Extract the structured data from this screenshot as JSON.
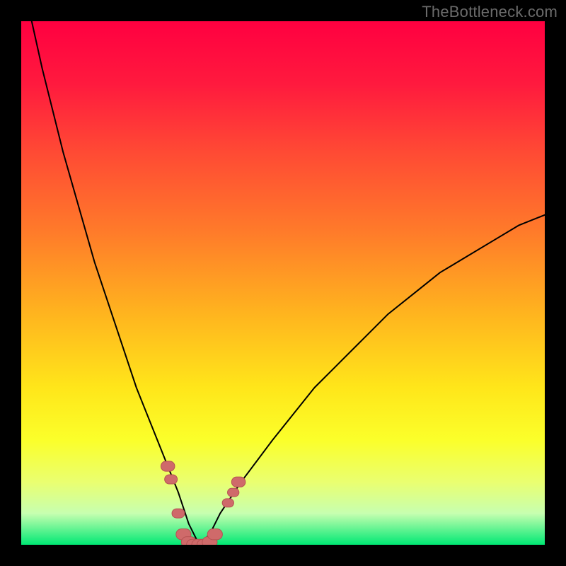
{
  "watermark": "TheBottleneck.com",
  "colors": {
    "curve": "#000000",
    "marker_fill": "#cf6a6a",
    "marker_stroke": "#b55252",
    "gradient_stops": [
      {
        "offset": "0%",
        "color": "#ff0040"
      },
      {
        "offset": "12%",
        "color": "#ff1a3e"
      },
      {
        "offset": "25%",
        "color": "#ff4a34"
      },
      {
        "offset": "40%",
        "color": "#ff7a2a"
      },
      {
        "offset": "55%",
        "color": "#ffb11f"
      },
      {
        "offset": "70%",
        "color": "#ffe61a"
      },
      {
        "offset": "80%",
        "color": "#fbff2a"
      },
      {
        "offset": "88%",
        "color": "#eaff70"
      },
      {
        "offset": "94%",
        "color": "#c7ffb0"
      },
      {
        "offset": "100%",
        "color": "#00e874"
      }
    ]
  },
  "chart_data": {
    "type": "line",
    "title": "",
    "xlabel": "",
    "ylabel": "",
    "xlim": [
      0,
      100
    ],
    "ylim": [
      0,
      100
    ],
    "x_optimum": 34,
    "series": [
      {
        "name": "bottleneck-curve",
        "x": [
          0,
          2,
          4,
          6,
          8,
          10,
          12,
          14,
          16,
          18,
          20,
          22,
          24,
          26,
          28,
          30,
          31,
          32,
          33,
          34,
          35,
          36,
          37,
          38,
          40,
          42,
          45,
          48,
          52,
          56,
          60,
          65,
          70,
          75,
          80,
          85,
          90,
          95,
          100
        ],
        "y": [
          110,
          100,
          91,
          83,
          75,
          68,
          61,
          54,
          48,
          42,
          36,
          30,
          25,
          20,
          15,
          10,
          7,
          4,
          2,
          0,
          1,
          2,
          4,
          6,
          9,
          12,
          16,
          20,
          25,
          30,
          34,
          39,
          44,
          48,
          52,
          55,
          58,
          61,
          63
        ]
      }
    ],
    "markers": [
      {
        "x": 28.0,
        "y": 15.0,
        "r": 1.2
      },
      {
        "x": 28.6,
        "y": 12.5,
        "r": 1.1
      },
      {
        "x": 30.0,
        "y": 6.0,
        "r": 1.1
      },
      {
        "x": 31.0,
        "y": 2.0,
        "r": 1.3
      },
      {
        "x": 32.0,
        "y": 0.5,
        "r": 1.3
      },
      {
        "x": 33.0,
        "y": 0.0,
        "r": 1.3
      },
      {
        "x": 34.0,
        "y": 0.0,
        "r": 1.3
      },
      {
        "x": 35.0,
        "y": 0.0,
        "r": 1.3
      },
      {
        "x": 36.0,
        "y": 0.5,
        "r": 1.3
      },
      {
        "x": 37.0,
        "y": 2.0,
        "r": 1.3
      },
      {
        "x": 39.5,
        "y": 8.0,
        "r": 1.0
      },
      {
        "x": 40.5,
        "y": 10.0,
        "r": 1.0
      },
      {
        "x": 41.5,
        "y": 12.0,
        "r": 1.2
      }
    ]
  }
}
